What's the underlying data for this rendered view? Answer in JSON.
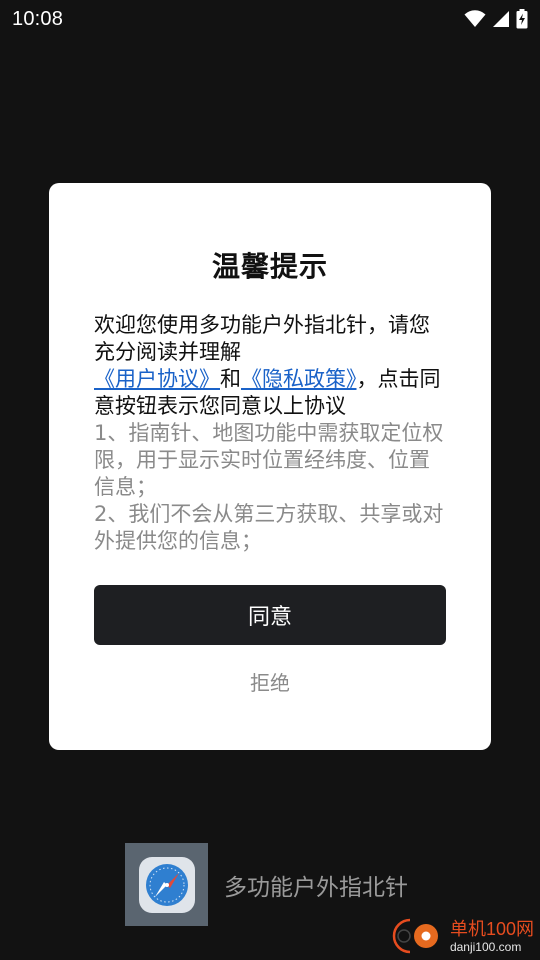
{
  "status_bar": {
    "time": "10:08",
    "icons": [
      "wifi-icon",
      "signal-icon",
      "battery-charging-icon"
    ]
  },
  "dialog": {
    "title": "温馨提示",
    "body": {
      "intro": "欢迎您使用多功能户外指北针，请您充分阅读并理解",
      "user_agreement_link": "《用户协议》",
      "and": "和",
      "privacy_policy_link": "《隐私政策》",
      "after_links": "，点击同意按钮表示您同意以上协议",
      "item1": "1、指南针、地图功能中需获取定位权限，用于显示实时位置经纬度、位置信息；",
      "item2": "2、我们不会从第三方获取、共享或对外提供您的信息；"
    },
    "agree_label": "同意",
    "reject_label": "拒绝"
  },
  "splash": {
    "app_name": "多功能户外指北针",
    "app_icon": "compass-app-icon"
  },
  "watermark": {
    "cn": "单机100网",
    "en": "danji100.com"
  },
  "colors": {
    "background": "#121212",
    "dialog_bg": "#ffffff",
    "button_bg": "#1e1f22",
    "link": "#1a62c8",
    "muted_text": "#8a8a8a"
  }
}
